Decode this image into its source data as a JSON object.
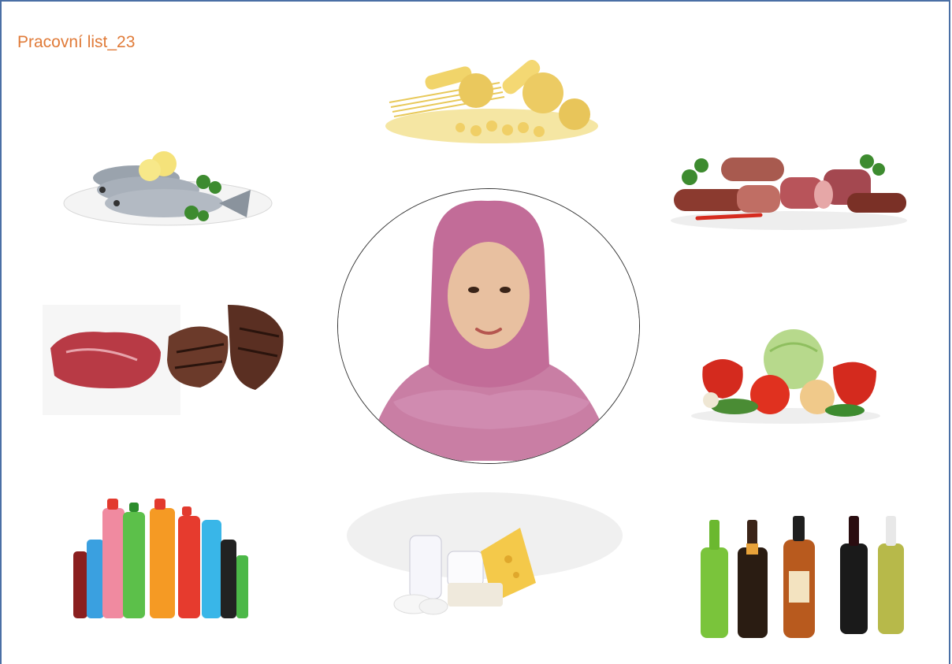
{
  "worksheet": {
    "title": "Pracovní list_23"
  },
  "images": [
    {
      "name": "pasta-image",
      "depicts": "pasta"
    },
    {
      "name": "fish-image",
      "depicts": "fish"
    },
    {
      "name": "sausages-image",
      "depicts": "sausages"
    },
    {
      "name": "meat-image",
      "depicts": "meat"
    },
    {
      "name": "vegetables-image",
      "depicts": "vegetables"
    },
    {
      "name": "soft-drinks-image",
      "depicts": "soft drinks"
    },
    {
      "name": "dairy-image",
      "depicts": "dairy"
    },
    {
      "name": "alcohol-image",
      "depicts": "alcoholic drinks"
    },
    {
      "name": "portrait-image",
      "depicts": "woman in hijab"
    }
  ]
}
